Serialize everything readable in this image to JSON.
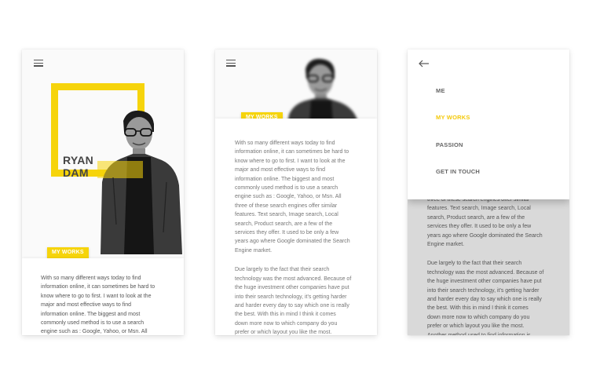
{
  "colors": {
    "accent": "#f6d40b",
    "text": "#777777",
    "heading": "#444444"
  },
  "screen1": {
    "menu_icon": "hamburger-icon",
    "name_line1": "RYAN",
    "name_line2": "DAM",
    "badge": "MY WORKS",
    "paragraph": "With so many different ways today to find\ninformation online, it can sometimes be hard to\nknow where to go to first. I want to look at the\nmajor and most effective ways to find\ninformation online.   The biggest and most\ncommonly used method is to use a search\nengine such as : Google, Yahoo, or Msn. All"
  },
  "screen2": {
    "menu_icon": "hamburger-icon",
    "badge": "MY WORKS",
    "paragraph1": "With so many different ways today to find\ninformation online, it can sometimes be hard to\nknow where to go to first. I want to look at the\nmajor and most effective ways to find\ninformation online.   The biggest and most\ncommonly used method is to use a search\nengine such as : Google, Yahoo, or Msn. All\nthree of these search engines offer similar\nfeatures. Text search, Image search, Local\nsearch, Product search, are a few of the\nservices they offer. It used to be only a few\nyears ago where Google dominated the Search\nEngine market.",
    "paragraph2": "Due largely to the fact that their search\ntechnology was the most advanced. Because of\nthe huge investment other companies have put\ninto their search technology, it's getting harder\nand harder every day to say which one is really\nthe best. With this in mind I think it comes\ndown more now to which company do you\nprefer or which layout you like the most.\nAnother method used to find information is"
  },
  "screen3": {
    "back_icon": "arrow-left-icon",
    "menu": [
      {
        "label": "ME",
        "active": false
      },
      {
        "label": "MY WORKS",
        "active": true
      },
      {
        "label": "PASSION",
        "active": false
      },
      {
        "label": "GET IN TOUCH",
        "active": false
      }
    ],
    "paragraph1": "three of these search engines offer similar\nfeatures. Text search, Image search, Local\nsearch, Product search, are a few of the\nservices they offer. It used to be only a few\nyears ago where Google dominated the Search\nEngine market.",
    "paragraph2": "Due largely to the fact that their search\ntechnology was the most advanced. Because of\nthe huge investment other companies have put\ninto their search technology, it's getting harder\nand harder every day to say which one is really\nthe best. With this in mind I think it comes\ndown more now to which company do you\nprefer or which layout you like the most.\nAnother method used to find information is"
  }
}
